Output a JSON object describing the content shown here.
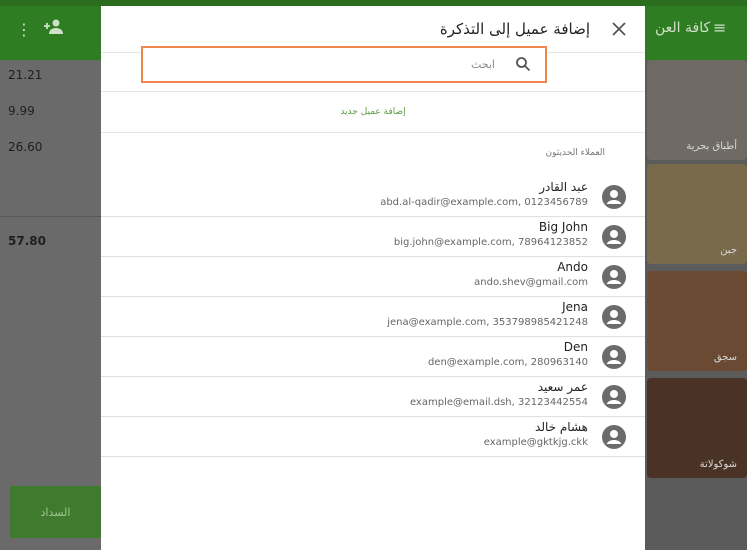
{
  "background": {
    "topbar_title": "كافة العن",
    "left_values": [
      "21.21",
      "9.99",
      "26.60",
      "57.80"
    ],
    "pay_label": "السداد",
    "categories": [
      {
        "label": "أطباق بحرية",
        "color": "#6f6a63"
      },
      {
        "label": "جبن",
        "color": "#7a6a4c"
      },
      {
        "label": "سجق",
        "color": "#6b4a34"
      },
      {
        "label": "شوكولاتة",
        "color": "#4b3226"
      }
    ]
  },
  "dialog": {
    "title": "إضافة عميل إلى التذكرة",
    "search_placeholder": "ابحث",
    "search_value": "",
    "add_new_label": "إضافة عميل جديد",
    "recent_label": "العملاء الحديثون",
    "customers": [
      {
        "name": "عبد القادر",
        "detail": "abd.al-qadir@example.com, 0123456789"
      },
      {
        "name": "Big John",
        "detail": "big.john@example.com, 78964123852"
      },
      {
        "name": "Ando",
        "detail": "ando.shev@gmail.com"
      },
      {
        "name": "Jena",
        "detail": "jena@example.com, 353798985421248"
      },
      {
        "name": "Den",
        "detail": "den@example.com, 280963140"
      },
      {
        "name": "عمر سعيد",
        "detail": "example@email.dsh, 32123442554"
      },
      {
        "name": "هشام خالد",
        "detail": "example@gktkjg.ckk"
      }
    ]
  },
  "colors": {
    "accent": "#5b9a45",
    "highlight": "#f0874a",
    "topbar": "#2f7d22"
  }
}
